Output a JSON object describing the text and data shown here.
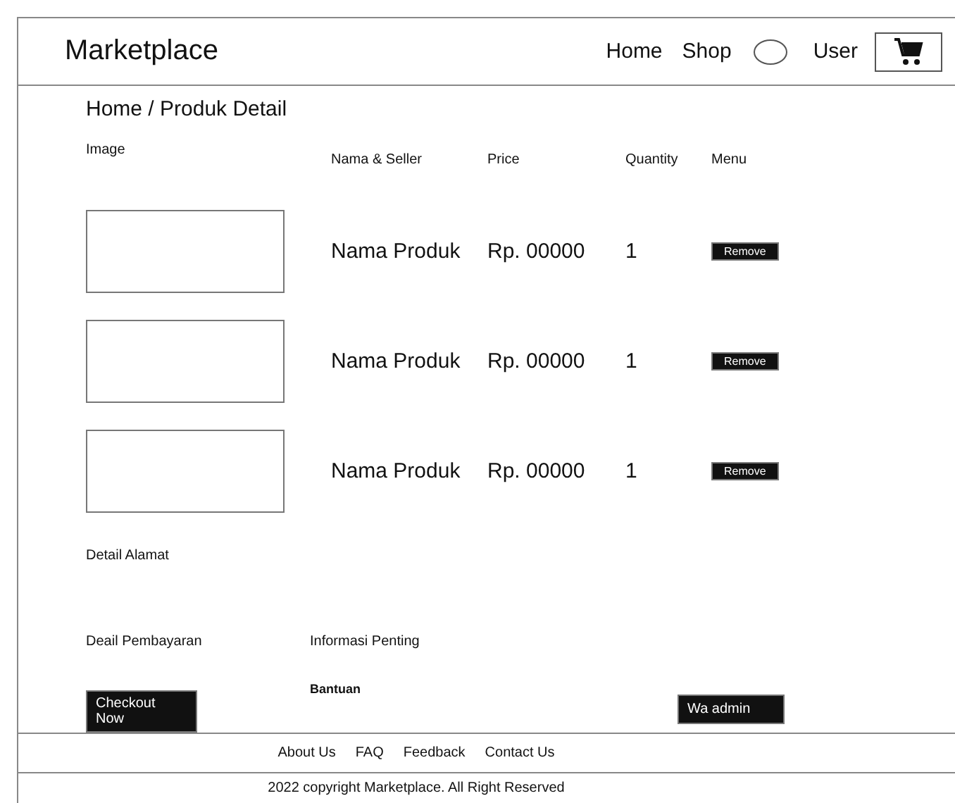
{
  "header": {
    "logo": "Marketplace",
    "nav": [
      "Home",
      "Shop"
    ],
    "user": "User"
  },
  "breadcrumb": "Home / Produk Detail",
  "table": {
    "image_label": "Image",
    "columns": [
      "Nama & Seller",
      "Price",
      "Quantity",
      "Menu"
    ],
    "rows": [
      {
        "name": "Nama Produk",
        "price": "Rp. 00000",
        "quantity": "1",
        "action": "Remove"
      },
      {
        "name": "Nama Produk",
        "price": "Rp. 00000",
        "quantity": "1",
        "action": "Remove"
      },
      {
        "name": "Nama Produk",
        "price": "Rp. 00000",
        "quantity": "1",
        "action": "Remove"
      }
    ]
  },
  "address_label": "Detail Alamat",
  "payment": {
    "label": "Deail Pembayaran",
    "button": "Checkout Now"
  },
  "info": {
    "label": "Informasi Penting",
    "help": "Bantuan",
    "button": "Wa admin"
  },
  "footer": {
    "links": [
      "About Us",
      "FAQ",
      "Feedback",
      "Contact Us"
    ],
    "copyright": "2022 copyright Marketplace. All Right Reserved"
  }
}
